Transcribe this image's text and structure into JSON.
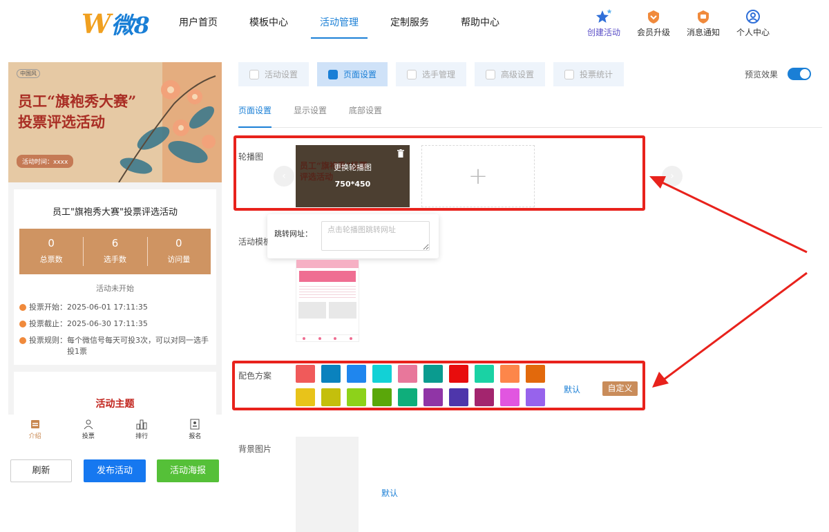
{
  "header": {
    "logo_w": "W",
    "logo_text": "微8",
    "nav": [
      {
        "label": "用户首页",
        "active": false
      },
      {
        "label": "模板中心",
        "active": false
      },
      {
        "label": "活动管理",
        "active": true
      },
      {
        "label": "定制服务",
        "active": false
      },
      {
        "label": "帮助中心",
        "active": false
      }
    ],
    "actions": [
      {
        "label": "创建活动",
        "icon": "stars-icon"
      },
      {
        "label": "会员升级",
        "icon": "vip-badge-icon"
      },
      {
        "label": "消息通知",
        "icon": "message-badge-icon"
      },
      {
        "label": "个人中心",
        "icon": "user-icon"
      }
    ]
  },
  "preview": {
    "banner_logos": "中国风",
    "banner_title_line1": "员工“旗袍秀大赛”",
    "banner_title_line2": "投票评选活动",
    "banner_time": "活动时间：xxxx",
    "event_title": "员工\"旗袍秀大赛\"投票评选活动",
    "stats": [
      {
        "value": "0",
        "label": "总票数"
      },
      {
        "value": "6",
        "label": "选手数"
      },
      {
        "value": "0",
        "label": "访问量"
      }
    ],
    "status": "活动未开始",
    "info": [
      {
        "key": "投票开始：",
        "value": "2025-06-01 17:11:35"
      },
      {
        "key": "投票截止：",
        "value": "2025-06-30 17:11:35"
      },
      {
        "key": "投票规则：",
        "value": "每个微信号每天可投3次，可以对同一选手投1票"
      }
    ],
    "topic": "活动主题",
    "tabs": [
      {
        "label": "介绍",
        "icon": "intro-icon",
        "active": true
      },
      {
        "label": "投票",
        "icon": "vote-icon",
        "active": false
      },
      {
        "label": "排行",
        "icon": "ranking-icon",
        "active": false
      },
      {
        "label": "报名",
        "icon": "signup-icon",
        "active": false
      }
    ]
  },
  "buttons": {
    "refresh": "刷新",
    "publish": "发布活动",
    "poster": "活动海报"
  },
  "settings": {
    "top_tabs": [
      {
        "label": "活动设置",
        "active": false
      },
      {
        "label": "页面设置",
        "active": true
      },
      {
        "label": "选手管理",
        "active": false
      },
      {
        "label": "高级设置",
        "active": false
      },
      {
        "label": "投票统计",
        "active": false
      }
    ],
    "preview_toggle_label": "预览效果",
    "preview_toggle_on": true,
    "sub_tabs": [
      {
        "label": "页面设置",
        "active": true
      },
      {
        "label": "显示设置",
        "active": false
      },
      {
        "label": "底部设置",
        "active": false
      }
    ],
    "carousel_label": "轮播图",
    "carousel_change_text": "更换轮播图",
    "carousel_size": "750*450",
    "carousel_thumb_title": "员工“旗袍秀”投票评选活动",
    "add_symbol": "+",
    "jump_url_label": "跳转网址：",
    "jump_url_placeholder": "点击轮播图跳转网址",
    "template_label": "活动模板",
    "color_label": "配色方案",
    "colors": [
      "#f05a5a",
      "#0a82be",
      "#1f86ee",
      "#12d1d6",
      "#e8779b",
      "#0a9b8f",
      "#e80d0d",
      "#1ad2a4",
      "#fd864a",
      "#e2690c",
      "#e8c31a",
      "#c4bf0c",
      "#8dd21a",
      "#5aa70a",
      "#0fae7b",
      "#9035a6",
      "#4e36ab",
      "#a3256e",
      "#e156e0",
      "#9763ec"
    ],
    "color_default": "默认",
    "color_custom": "自定义",
    "bg_label": "背景图片",
    "bg_default": "默认"
  }
}
